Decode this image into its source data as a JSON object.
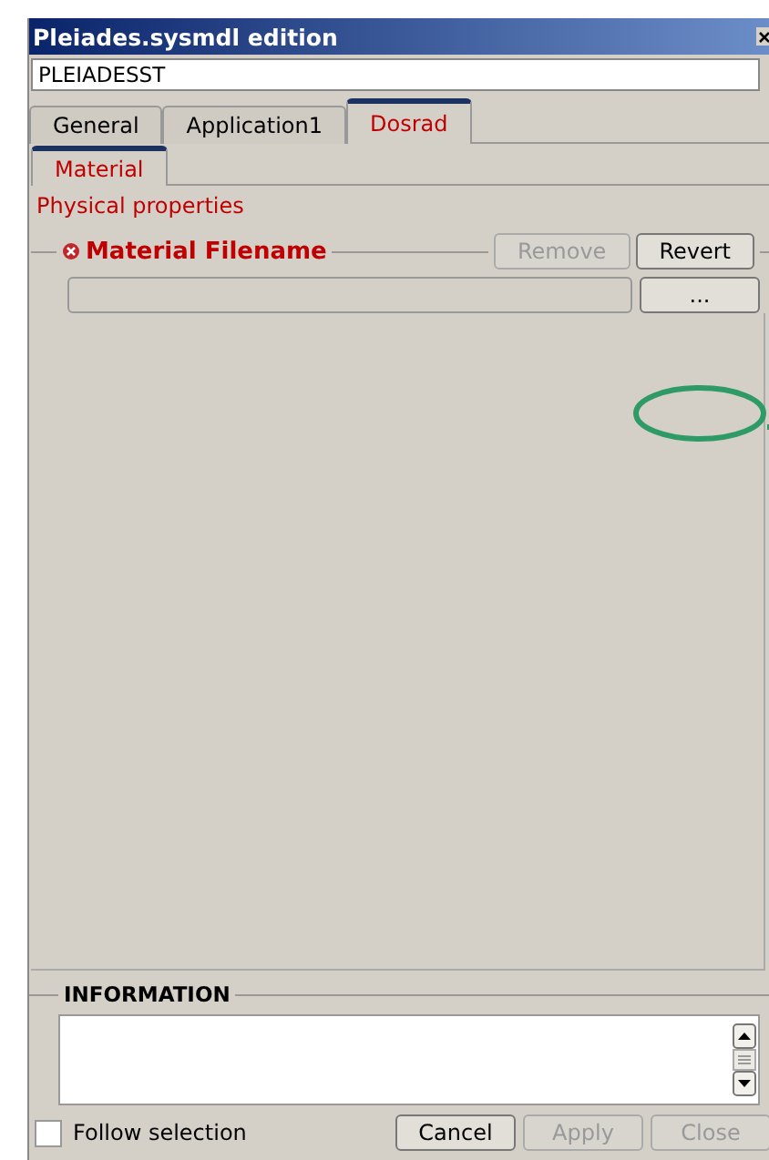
{
  "window": {
    "title": "Pleiades.sysmdl edition"
  },
  "name_field": {
    "value": "PLEIADESST"
  },
  "tabs": [
    {
      "label": "General",
      "selected": false
    },
    {
      "label": "Application1",
      "selected": false
    },
    {
      "label": "Dosrad",
      "selected": true
    }
  ],
  "subtabs": [
    {
      "label": "Material",
      "selected": true
    }
  ],
  "section_title": "Physical properties",
  "group": {
    "title": "Material Filename",
    "required": true,
    "buttons": [
      {
        "label": "Remove",
        "disabled": true
      },
      {
        "label": "Revert",
        "disabled": false
      }
    ],
    "file_field": {
      "disabled": true
    },
    "browse_button": {
      "label": "...",
      "disabled": false
    }
  },
  "information": {
    "title": "INFORMATION"
  },
  "follow_selection": {
    "label": "Follow selection",
    "checked": false
  },
  "buttons": [
    {
      "label": "Cancel",
      "disabled": false
    },
    {
      "label": "Apply",
      "disabled": true
    },
    {
      "label": "Close",
      "disabled": true
    }
  ]
}
